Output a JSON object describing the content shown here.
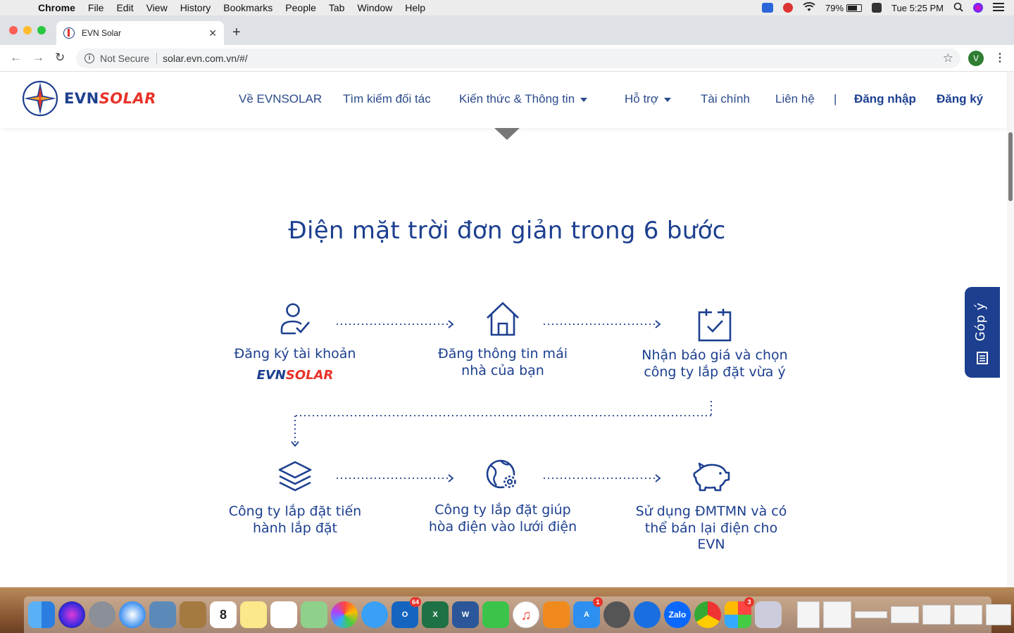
{
  "menubar": {
    "app": "Chrome",
    "items": [
      "File",
      "Edit",
      "View",
      "History",
      "Bookmarks",
      "People",
      "Tab",
      "Window",
      "Help"
    ],
    "battery": "79%",
    "battery_level": 0.79,
    "clock": "Tue 5:25 PM"
  },
  "browser": {
    "tab_title": "EVN Solar",
    "security_label": "Not Secure",
    "url": "solar.evn.com.vn/#/",
    "profile_initial": "V"
  },
  "site": {
    "logo": {
      "part1": "EVN",
      "part2": "SOLAR"
    },
    "nav": {
      "about": "Về EVNSOLAR",
      "partners": "Tìm kiếm đối tác",
      "knowledge": "Kiến thức & Thông tin",
      "support": "Hỗ trợ",
      "finance": "Tài chính",
      "contact": "Liên hệ",
      "divider": "|",
      "login": "Đăng nhập",
      "register": "Đăng ký"
    },
    "section_title": "Điện mặt trời đơn giản trong 6 bước",
    "steps": [
      {
        "label": "Đăng ký tài khoản",
        "icon": "user-check-icon"
      },
      {
        "label": "Đăng thông tin mái nhà của bạn",
        "icon": "house-icon"
      },
      {
        "label": "Nhận báo giá và chọn công ty lắp đặt vừa ý",
        "icon": "calendar-check-icon"
      },
      {
        "label": "Công ty lắp đặt tiến hành lắp đặt",
        "icon": "layers-icon"
      },
      {
        "label": "Công ty lắp đặt giúp hòa điện vào lưới điện",
        "icon": "globe-gear-icon"
      },
      {
        "label": "Sử dụng ĐMTMN và có thể bán lại điện cho EVN",
        "icon": "piggy-bank-icon"
      }
    ],
    "step1_logo": {
      "part1": "EVN",
      "part2": "SOLAR"
    },
    "feedback_button": "Góp ý"
  },
  "dock": {
    "outlook_badge": "64",
    "appstore_badge": "1",
    "other_badge": "3"
  }
}
